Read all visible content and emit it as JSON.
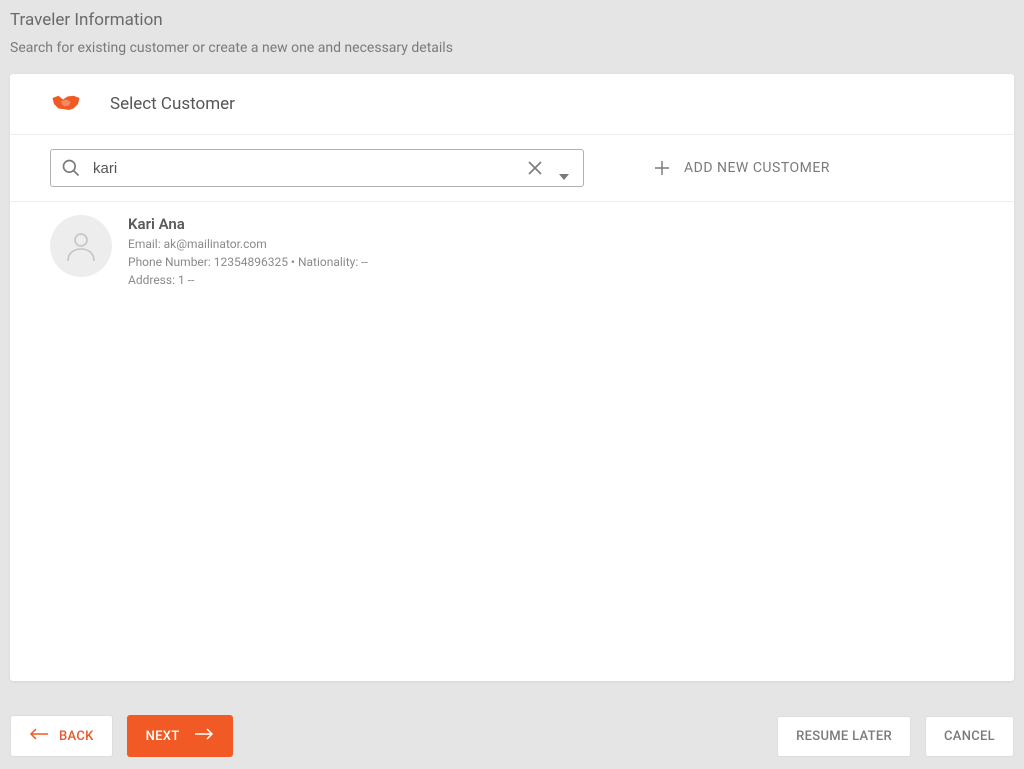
{
  "header": {
    "title": "Traveler Information",
    "subtitle": "Search for existing customer or create a new one and necessary details"
  },
  "section": {
    "title": "Select Customer"
  },
  "search": {
    "value": "kari",
    "placeholder": ""
  },
  "addCustomer": {
    "label": "ADD NEW CUSTOMER"
  },
  "results": [
    {
      "name": "Kari Ana",
      "email_label": "Email: ",
      "email": "ak@mailinator.com",
      "phone_label": "Phone Number: ",
      "phone": "12354896325",
      "nationality_label": "Nationality: ",
      "nationality": "--",
      "address_label": "Address: ",
      "address": "1 --"
    }
  ],
  "footer": {
    "back": "BACK",
    "next": "NEXT",
    "resume": "RESUME LATER",
    "cancel": "CANCEL"
  }
}
